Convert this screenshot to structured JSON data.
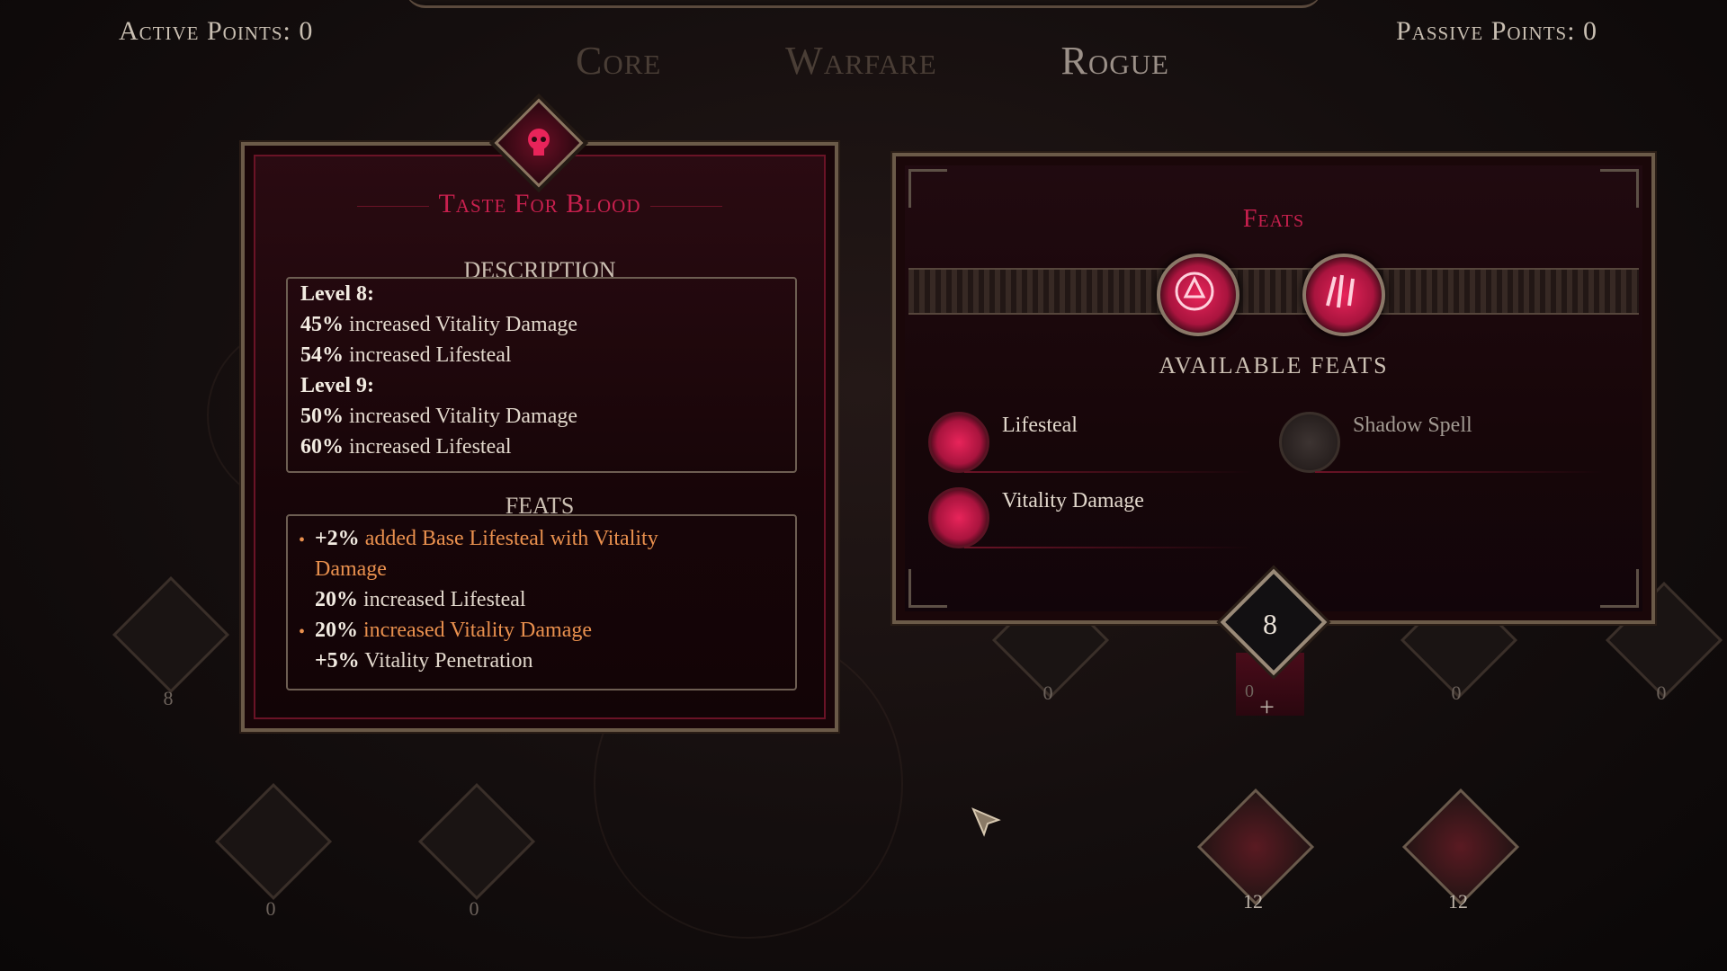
{
  "header": {
    "active_points_label": "Active Points: 0",
    "passive_points_label": "Passive Points: 0",
    "tabs": [
      {
        "label": "Core",
        "active": false
      },
      {
        "label": "Warfare",
        "active": false
      },
      {
        "label": "Rogue",
        "active": true
      }
    ]
  },
  "skill_panel": {
    "title": "Taste For Blood",
    "crest_icon": "skull-icon",
    "description_heading": "DESCRIPTION",
    "description_lines": [
      {
        "bold": "Level 8:",
        "text": ""
      },
      {
        "bold": "45%",
        "text": " increased Vitality Damage"
      },
      {
        "bold": "54%",
        "text": " increased Lifesteal"
      },
      {
        "bold": "Level 9:",
        "text": ""
      },
      {
        "bold": "50%",
        "text": " increased Vitality Damage"
      },
      {
        "bold": "60%",
        "text": " increased Lifesteal"
      }
    ],
    "feats_heading": "FEATS",
    "feats": [
      {
        "bullet": true,
        "bold": "+2%",
        "text": " added Base Lifesteal with Vitality"
      },
      {
        "bullet": false,
        "bold": "",
        "text": "Damage"
      },
      {
        "bullet": false,
        "bold": "20%",
        "text": " increased Lifesteal",
        "plain": true
      },
      {
        "bullet": true,
        "bold": "20%",
        "text": " increased Vitality Damage"
      },
      {
        "bullet": false,
        "bold": "+5%",
        "text": " Vitality Penetration",
        "plain": true
      }
    ]
  },
  "feats_panel": {
    "title": "Feats",
    "equipped": [
      {
        "icon": "lifesteal-emblem-icon"
      },
      {
        "icon": "vitality-claw-icon"
      }
    ],
    "available_heading": "AVAILABLE FEATS",
    "available": [
      {
        "label": "Lifesteal",
        "icon": "lifesteal-emblem-icon",
        "enabled": true
      },
      {
        "label": "Shadow Spell",
        "icon": "shadow-claw-icon",
        "enabled": false
      },
      {
        "label": "Vitality Damage",
        "icon": "vitality-claw-icon",
        "enabled": true
      }
    ]
  },
  "rank": {
    "value": "8",
    "add_symbol": "+",
    "under_value": "0"
  },
  "tree_nodes": [
    {
      "label": "8",
      "lit": false
    },
    {
      "label": "0",
      "lit": false
    },
    {
      "label": "0",
      "lit": false
    },
    {
      "label": "0",
      "lit": false
    },
    {
      "label": "0",
      "lit": false
    },
    {
      "label": "0",
      "lit": false
    },
    {
      "label": "12",
      "lit": true
    },
    {
      "label": "12",
      "lit": true
    }
  ],
  "colors": {
    "accent_crimson": "#c8204e",
    "feat_orange": "#e9904e",
    "frame_gold": "#6b5a48"
  }
}
